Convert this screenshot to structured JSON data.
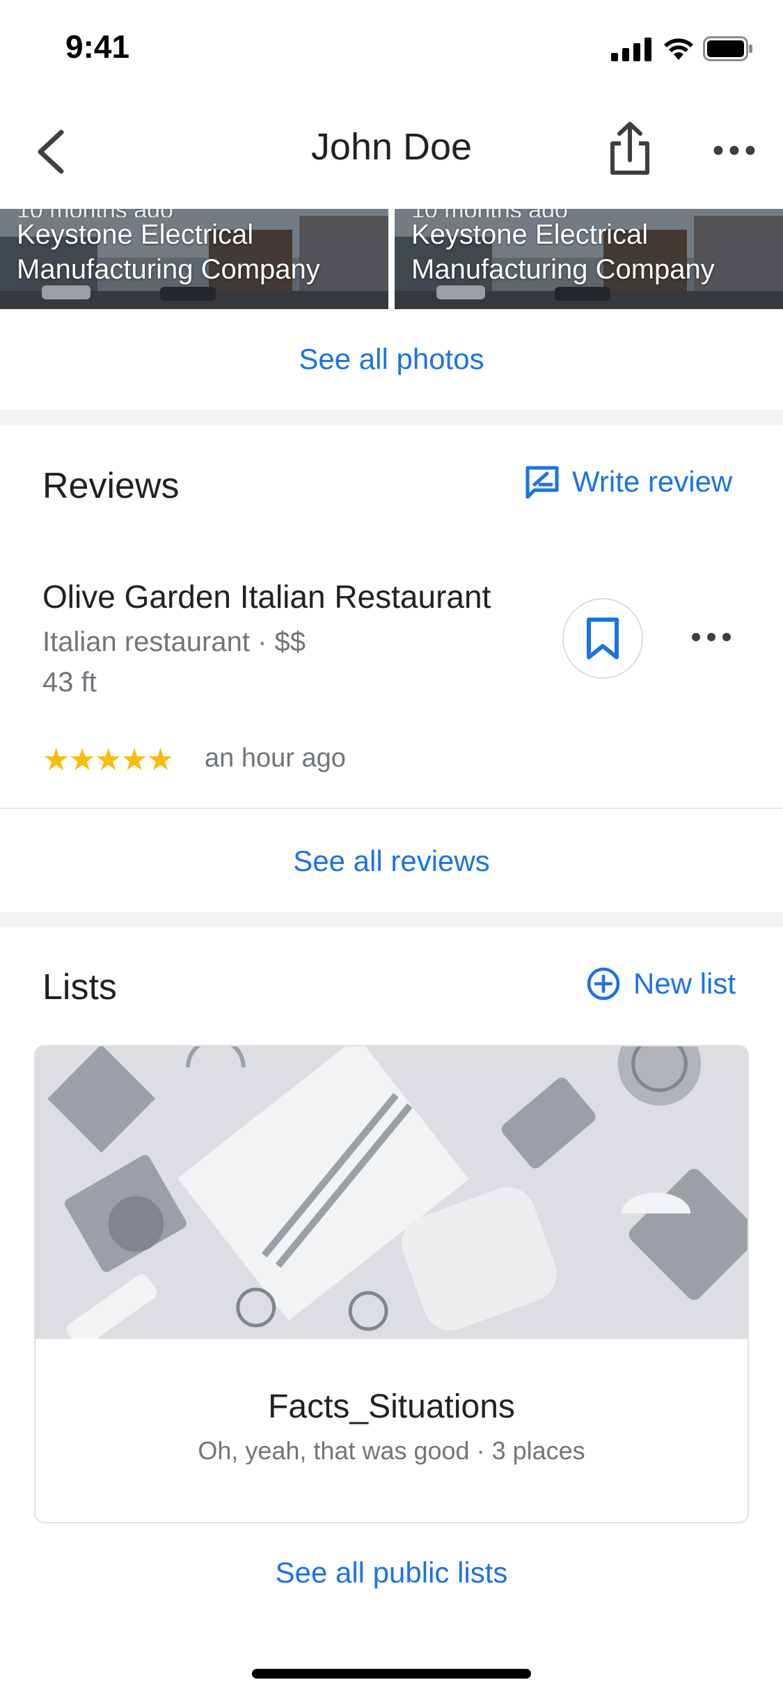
{
  "status_bar": {
    "time": "9:41"
  },
  "header": {
    "title": "John Doe"
  },
  "photos": [
    {
      "faded_line": "10 months ago",
      "caption": "Keystone Electrical Manufacturing Company"
    },
    {
      "faded_line": "10 months ago",
      "caption": "Keystone Electrical Manufacturing Company"
    }
  ],
  "photos_section": {
    "see_all": "See all photos"
  },
  "reviews": {
    "title": "Reviews",
    "write_review": "Write review",
    "item": {
      "name": "Olive Garden Italian Restaurant",
      "meta": "Italian restaurant · $$",
      "distance": "43 ft",
      "stars": "★★★★★",
      "rating": 5,
      "time": "an hour ago"
    },
    "see_all": "See all reviews"
  },
  "lists": {
    "title": "Lists",
    "new_list": "New list",
    "card": {
      "name": "Facts_Situations",
      "meta": "Oh, yeah, that was good · 3 places"
    },
    "see_all": "See all public lists"
  },
  "colors": {
    "accent": "#1a73e8",
    "star": "#fbbc04",
    "divider": "#f1f3f4"
  },
  "icons": [
    "signal-icon",
    "wifi-icon",
    "battery-icon",
    "back-arrow-icon",
    "share-icon",
    "more-icon",
    "write-review-icon",
    "bookmark-icon",
    "add-circle-icon"
  ]
}
